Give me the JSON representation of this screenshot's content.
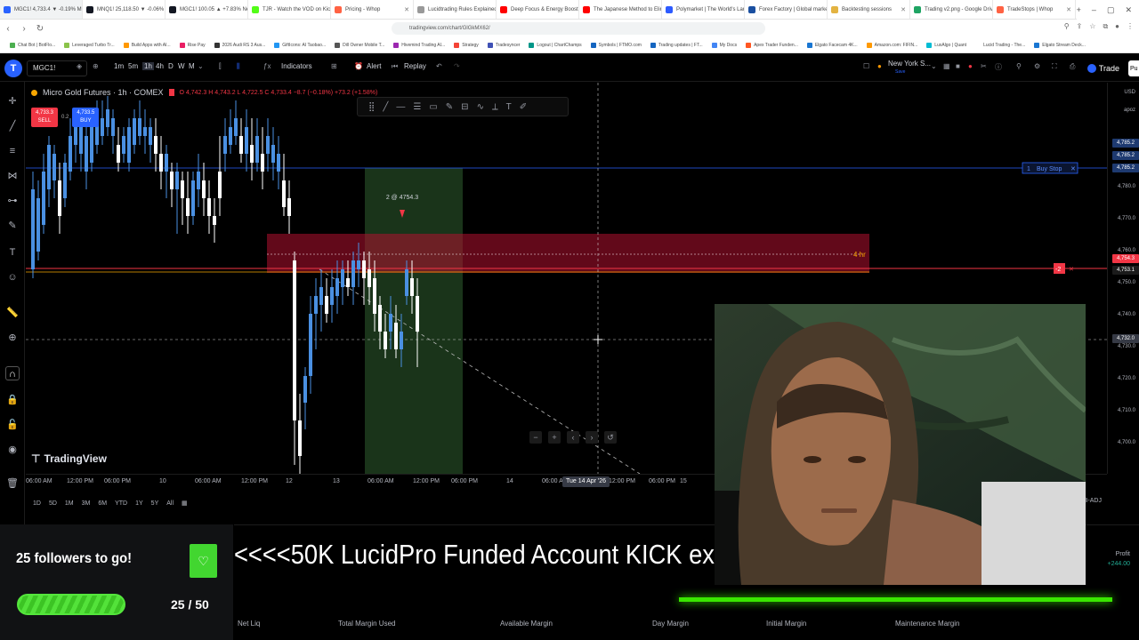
{
  "browser": {
    "tabs": [
      {
        "label": "MGC1! 4,733.4 ▼ -0.19% Mi",
        "color": "#2962ff",
        "active": true
      },
      {
        "label": "MNQ1! 25,118.50 ▼ -0.06% N",
        "color": "#131722",
        "active": false
      },
      {
        "label": "MGC1! 100.05 ▲ +7.83% NewMo",
        "color": "#131722",
        "active": false
      },
      {
        "label": "TJR - Watch the VOD on Kick",
        "color": "#53fc18",
        "active": false
      },
      {
        "label": "Pricing - Whop",
        "color": "#ff6243",
        "active": false
      },
      {
        "label": "Lucidtrading Rules Explained",
        "color": "#999999",
        "active": false
      },
      {
        "label": "Deep Focus & Energy Boost",
        "color": "#ff0000",
        "active": false
      },
      {
        "label": "The Japanese Method to Eliminate",
        "color": "#ff0000",
        "active": false
      },
      {
        "label": "Polymarket | The World's Largest Pr",
        "color": "#2d5bff",
        "active": false
      },
      {
        "label": "Forex Factory | Global markets for th",
        "color": "#1a4fa0",
        "active": false
      },
      {
        "label": "Backtesting sessions",
        "color": "#e3b341",
        "active": false
      },
      {
        "label": "Trading v2.png - Google Drive",
        "color": "#1fa463",
        "active": false
      },
      {
        "label": "TradeStops | Whop",
        "color": "#ff6243",
        "active": false
      }
    ],
    "url": "tradingview.com/chart/GlGkMX62/",
    "bookmarks": [
      {
        "label": "Chat Bot | BotFlo...",
        "color": "#4caf50"
      },
      {
        "label": "Leveraged Turbo Tr...",
        "color": "#8bc34a"
      },
      {
        "label": "Build Apps with AI...",
        "color": "#ff9800"
      },
      {
        "label": "Rise Pay",
        "color": "#e91e63"
      },
      {
        "label": "2026 Audi RS 3 Aus...",
        "color": "#333333"
      },
      {
        "label": "GiftIcons: AI Taobao...",
        "color": "#2196f3"
      },
      {
        "label": "Dill Owner Mobile T...",
        "color": "#555555"
      },
      {
        "label": "Hivemind Trading AI...",
        "color": "#9c27b0"
      },
      {
        "label": "Strategy",
        "color": "#f44336"
      },
      {
        "label": "Tradesyncer",
        "color": "#3f51b5"
      },
      {
        "label": "Logout | ChartChamps",
        "color": "#009688"
      },
      {
        "label": "Symbols | FTMO.com",
        "color": "#1565c0"
      },
      {
        "label": "Trading updates | FT...",
        "color": "#1565c0"
      },
      {
        "label": "My Docs",
        "color": "#4285f4"
      },
      {
        "label": "Apex Trader Funden...",
        "color": "#ff5722"
      },
      {
        "label": "Elgato Facecam 4K...",
        "color": "#1976d2"
      },
      {
        "label": "Amazon.com: FIFIN...",
        "color": "#ff9900"
      },
      {
        "label": "LuxAlgo | Quant",
        "color": "#00bcd4"
      },
      {
        "label": "Lucid Trading - The...",
        "color": "#ffffff"
      },
      {
        "label": "Elgato Stream Deck...",
        "color": "#1976d2"
      }
    ]
  },
  "toolbar": {
    "symbol": "MGC1!",
    "intervals": [
      "1m",
      "5m",
      "1h",
      "4h",
      "D",
      "W",
      "M"
    ],
    "indicators_label": "Indicators",
    "alert_label": "Alert",
    "replay_label": "Replay",
    "timezone_label": "New York S...",
    "timezone_sub": "Save",
    "trade_label": "Trade",
    "publish_label": "Pu"
  },
  "chart": {
    "legend_title": "Micro Gold Futures · 1h · COMEX",
    "legend_ohlc": "O 4,742.3 H 4,743.2 L 4,722.5 C 4,733.4 −8.7 (−0.18%) +73.2 (+1.58%)",
    "sell_price": "4,733.3",
    "sell_label": "SELL",
    "buy_price": "4,733.5",
    "buy_label": "BUY",
    "spread": "0.2",
    "watermark": "TradingView",
    "fill_label": "2 @ 4754.3",
    "zone_label": "4 hr",
    "buy_stop_qty": "1",
    "buy_stop_label": "Buy Stop",
    "position_qty": "-2",
    "candle_up_color": "#4a90e2",
    "candle_down_color": "#ffffff",
    "zone_color": "#b2102f"
  },
  "price_axis": {
    "currency": "USD",
    "sub": "apoz",
    "ticks": [
      "4,785.2",
      "4,780.0",
      "4,770.0",
      "4,760.0",
      "4,750.0",
      "4,740.0",
      "4,730.0",
      "4,720.0",
      "4,710.0",
      "4,700.0"
    ],
    "labels": {
      "buy_stop_a": "4,785.2",
      "buy_stop_b": "4,785.2",
      "position": "4,754.3",
      "last": "4,753.1",
      "cursor": "4,732.0"
    }
  },
  "time_axis": {
    "ticks": [
      "06:00 AM",
      "12:00 PM",
      "06:00 PM",
      "10",
      "06:00 AM",
      "12:00 PM",
      "12",
      "13",
      "06:00 AM",
      "12:00 PM",
      "06:00 PM",
      "14",
      "06:00 AM",
      "12:00 PM",
      "06:00 PM",
      "15"
    ],
    "cursor": "Tue 14 Apr '26"
  },
  "range_bar": {
    "ranges": [
      "1D",
      "5D",
      "1M",
      "3M",
      "6M",
      "YTD",
      "1Y",
      "5Y",
      "All"
    ],
    "right": [
      "ETH",
      "B-ADJ"
    ]
  },
  "account": {
    "columns": [
      "Net Liq",
      "Total Margin Used",
      "Available Margin",
      "Day Margin",
      "Initial Margin",
      "Maintenance Margin"
    ],
    "profit_label": "Profit",
    "profit_value": "+244.00"
  },
  "overlay": {
    "follow_title": "25 followers to go!",
    "follow_count": "25 / 50",
    "follow_progress": 0.5,
    "giveaway_text": "<<<<50K LucidPro Funded Account KICK exclusive GIVEAWAY ."
  }
}
